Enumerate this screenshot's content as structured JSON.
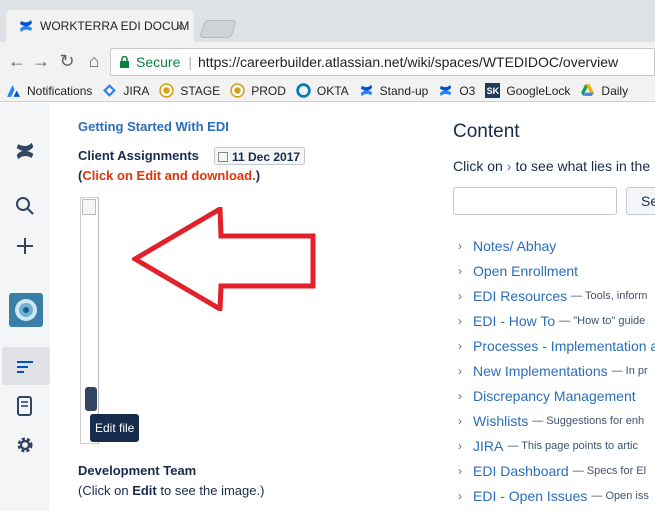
{
  "browser": {
    "tab_title": "WORKTERRA EDI DOCUM",
    "tab_close": "×",
    "secure_label": "Secure",
    "url": "https://careerbuilder.atlassian.net/wiki/spaces/WTEDIDOC/overview",
    "bookmarks": [
      {
        "label": "Notifications",
        "icon": "atlassian-icon",
        "color": "#2684ff"
      },
      {
        "label": "JIRA",
        "icon": "jira-icon",
        "color": "#2684ff"
      },
      {
        "label": "STAGE",
        "icon": "stage-icon",
        "color": "#d4a017"
      },
      {
        "label": "PROD",
        "icon": "prod-icon",
        "color": "#d4a017"
      },
      {
        "label": "OKTA",
        "icon": "okta-icon",
        "color": "#007dc1"
      },
      {
        "label": "Stand-up",
        "icon": "confluence-icon",
        "color": "#2684ff"
      },
      {
        "label": "O3",
        "icon": "confluence-icon",
        "color": "#2684ff"
      },
      {
        "label": "GoogleLock",
        "icon": "sk-icon",
        "color": "#1f3b57"
      },
      {
        "label": "Daily",
        "icon": "drive-icon",
        "color": "#f4b400"
      }
    ],
    "sk_text": "SK"
  },
  "main": {
    "getting_started": "Getting Started With EDI",
    "client_assignments": "Client Assignments",
    "date": "11 Dec 2017",
    "red_open": "(",
    "red_text": "Click on Edit and download.",
    "red_close": ")",
    "tooltip": "Edit file",
    "dev_team": "Development Team",
    "dev_note_pre": "(Click on ",
    "dev_note_bold": "Edit",
    "dev_note_post": " to see the image.)"
  },
  "sidebar_content": {
    "title": "Content",
    "hint_pre": "Click on",
    "hint_chev": "›",
    "hint_post": "to see what lies in the",
    "search_button": "Se",
    "items": [
      {
        "title": "Notes/ Abhay",
        "desc": ""
      },
      {
        "title": "Open Enrollment",
        "desc": ""
      },
      {
        "title": "EDI Resources",
        "desc": "— Tools, inform"
      },
      {
        "title": "EDI - How To",
        "desc": "— \"How to\" guide"
      },
      {
        "title": "Processes - Implementation a",
        "desc": ""
      },
      {
        "title": "New Implementations",
        "desc": "— In pr"
      },
      {
        "title": "Discrepancy Management",
        "desc": ""
      },
      {
        "title": "Wishlists",
        "desc": "— Suggestions for enh"
      },
      {
        "title": "JIRA",
        "desc": "— This page points to artic"
      },
      {
        "title": "EDI Dashboard",
        "desc": "— Specs for El"
      },
      {
        "title": "EDI - Open Issues",
        "desc": "— Open iss"
      }
    ]
  },
  "colors": {
    "link": "#2a6ebb",
    "red": "#de350b",
    "arrow": "#e1222a"
  }
}
